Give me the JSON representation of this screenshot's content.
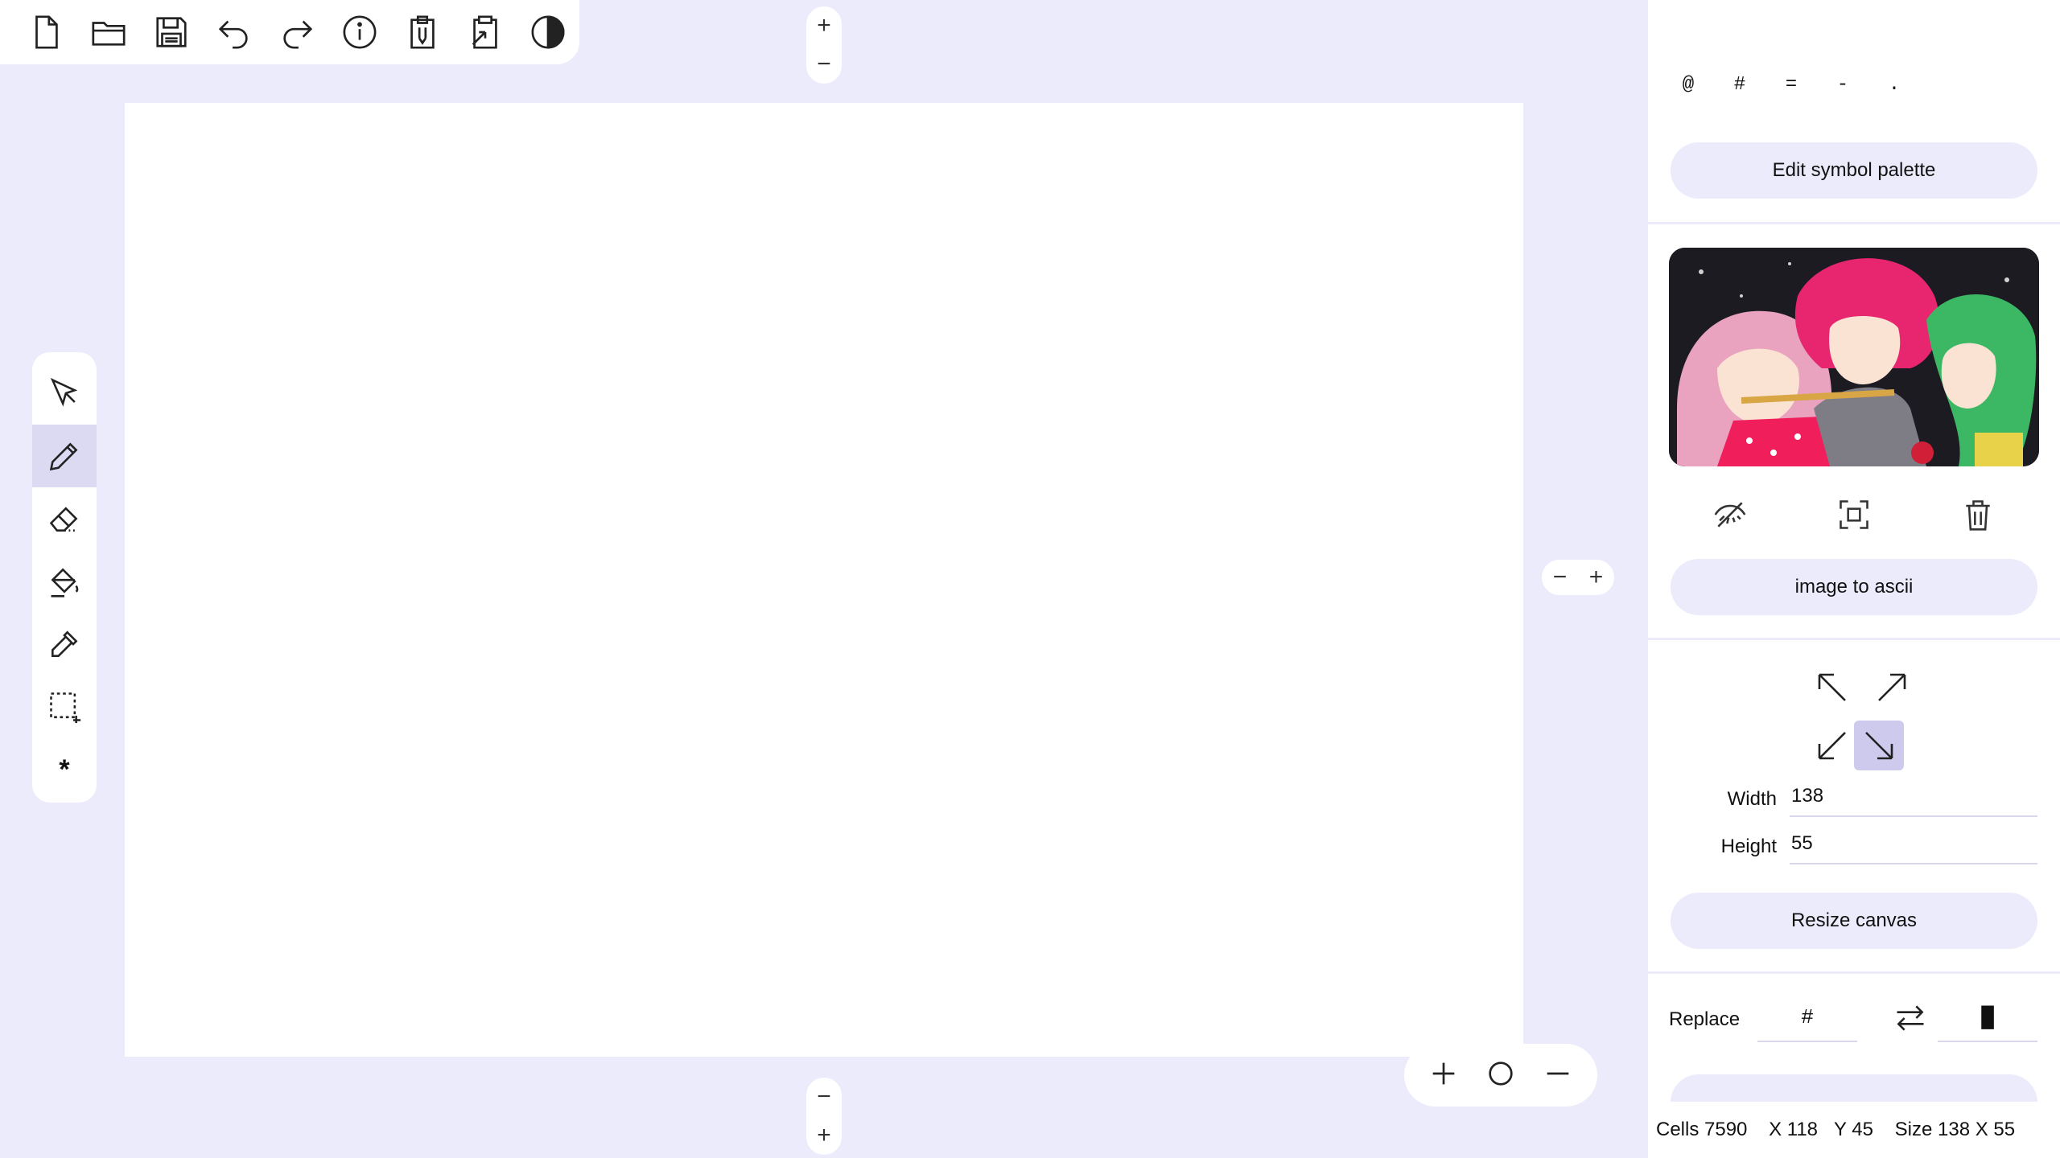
{
  "toolbar": {
    "buttons": [
      {
        "name": "new-file-button",
        "icon": "new-file-icon"
      },
      {
        "name": "open-folder-button",
        "icon": "folder-icon"
      },
      {
        "name": "save-button",
        "icon": "floppy-disk-icon"
      },
      {
        "name": "undo-button",
        "icon": "undo-icon"
      },
      {
        "name": "redo-button",
        "icon": "redo-icon"
      },
      {
        "name": "info-button",
        "icon": "info-icon"
      },
      {
        "name": "copy-button",
        "icon": "clipboard-copy-icon"
      },
      {
        "name": "paste-button",
        "icon": "clipboard-paste-icon"
      },
      {
        "name": "theme-toggle-button",
        "icon": "contrast-icon"
      }
    ]
  },
  "tools": [
    "select-tool",
    "pencil-tool",
    "eraser-tool",
    "fill-tool",
    "eyedropper-tool",
    "marquee-tool",
    "symbol-tool"
  ],
  "tool_symbol": "*",
  "active_tool": "pencil-tool",
  "steppers": {
    "plus": "+",
    "minus": "−"
  },
  "ascii_art": "",
  "palette": {
    "symbols": [
      "@",
      "#",
      "=",
      "-",
      "."
    ],
    "edit_label": "Edit symbol palette"
  },
  "image_panel": {
    "convert_label": "image to ascii"
  },
  "resize": {
    "width_label": "Width",
    "width_value": "138",
    "height_label": "Height",
    "height_value": "55",
    "button_label": "Resize canvas",
    "active_anchor": "bottom-right"
  },
  "replace": {
    "label": "Replace",
    "from": "#",
    "to": "█"
  },
  "status": {
    "cells": "Cells 7590",
    "x": "X 118",
    "y": "Y 45",
    "size": "Size 138 X 55"
  },
  "colors": {
    "background": "#ecebfb",
    "accent": "#cdcaed",
    "pill": "#ecebfb"
  }
}
